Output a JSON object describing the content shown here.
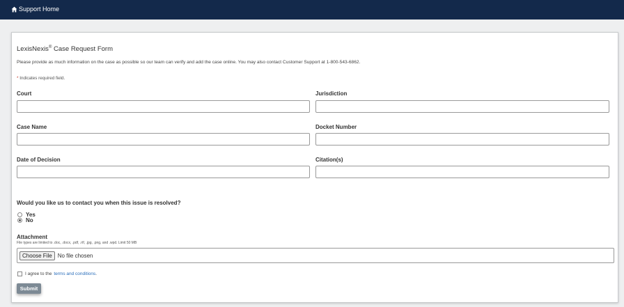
{
  "header": {
    "home_label": "Support Home",
    "home_icon": "home-icon"
  },
  "form": {
    "title_main": "LexisNexis",
    "title_reg": "®",
    "title_rest": " Case Request Form",
    "intro": "Please provide as much information on the case as possible so our team can verify and add the case online. You may also contact Customer Support at 1-800-543-6862.",
    "required_star": "*",
    "required_note": " Indicates required field.",
    "fields": {
      "court": {
        "label": "Court",
        "value": ""
      },
      "jurisdiction": {
        "label": "Jurisdiction",
        "value": ""
      },
      "case_name": {
        "label": "Case Name",
        "value": ""
      },
      "docket_number": {
        "label": "Docket Number",
        "value": ""
      },
      "date_of_decision": {
        "label": "Date of Decision",
        "value": ""
      },
      "citations": {
        "label": "Citation(s)",
        "value": ""
      }
    },
    "contact_question": "Would you like us to contact you when this issue is resolved?",
    "contact_options": [
      {
        "label": "Yes",
        "selected": false
      },
      {
        "label": "No",
        "selected": true
      }
    ],
    "attachment_label": "Attachment",
    "attachment_hint": "File types are limited to .doc, .docx, .pdf, .rtf, .jpg, .png, and .wpd. Limit 50 MB",
    "choose_file_label": "Choose File",
    "no_file_text": "No file chosen",
    "agree_text": "I agree to the",
    "terms_link": "terms and conditions",
    "agree_period": ".",
    "agree_checked": false,
    "submit_label": "Submit"
  },
  "colors": {
    "header_bg": "#13294b",
    "page_bg": "#eeeff0",
    "submit_bg": "#7d8a95",
    "link": "#2a6ebb",
    "required": "#c0392b"
  }
}
